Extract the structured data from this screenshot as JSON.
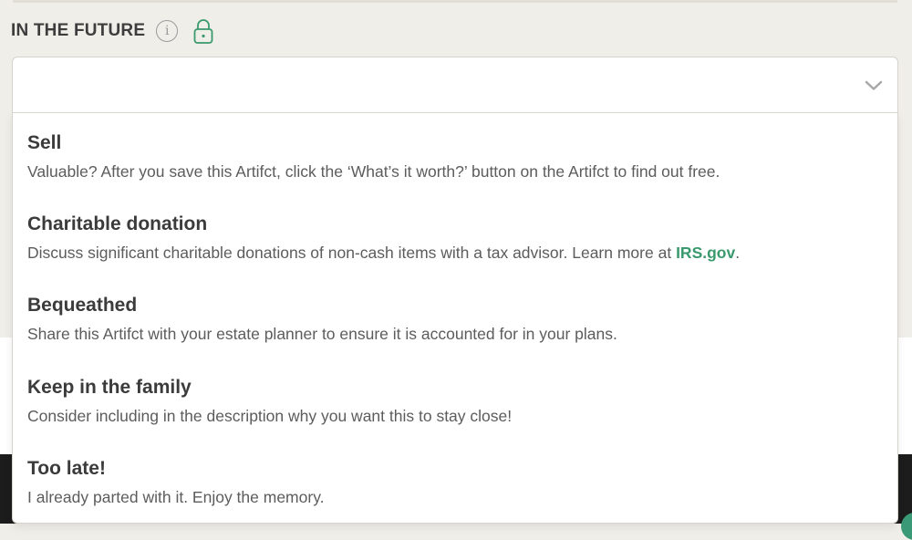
{
  "section": {
    "title": "IN THE FUTURE",
    "info_icon": "info-icon",
    "lock_icon": "lock-icon"
  },
  "select": {
    "value": "",
    "chevron_icon": "chevron-down-icon"
  },
  "options": [
    {
      "title": "Sell",
      "description": "Valuable? After you save this Artifct, click the ‘What’s it worth?’ button on the Artifct to find out free."
    },
    {
      "title": "Charitable donation",
      "description_before": "Discuss significant charitable donations of non-cash items with a tax advisor. Learn more at ",
      "link_text": "IRS.gov",
      "description_after": "."
    },
    {
      "title": "Bequeathed",
      "description": "Share this Artifct with your estate planner to ensure it is accounted for in your plans."
    },
    {
      "title": "Keep in the family",
      "description": "Consider including in the description why you want this to stay close!"
    },
    {
      "title": "Too late!",
      "description": "I already parted with it. Enjoy the memory."
    }
  ],
  "colors": {
    "page_bg": "#f0eee9",
    "link": "#3a9a6e",
    "icon": "#9a9a9a",
    "lock": "#3a9a6e",
    "footer": "#1c1c1c"
  }
}
